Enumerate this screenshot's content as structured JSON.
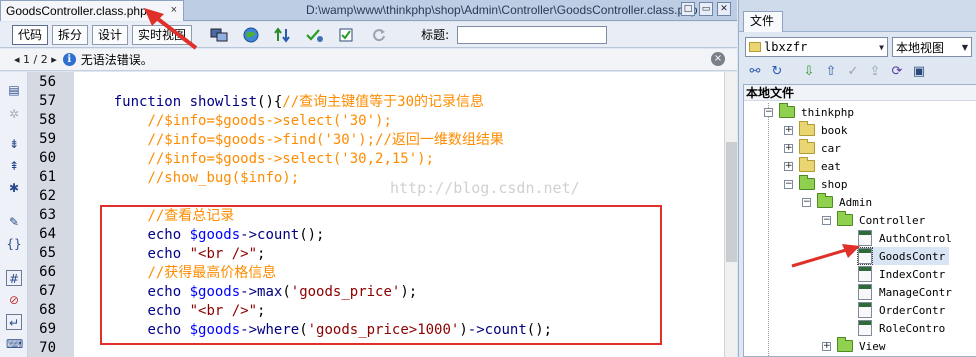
{
  "editor": {
    "tab_title": "GoodsController.class.php",
    "tab_close": "×",
    "file_path": "D:\\wamp\\www\\thinkphp\\shop\\Admin\\Controller\\GoodsController.class.php",
    "window_icons": [
      "□",
      "▭",
      "✕"
    ],
    "toolbar": {
      "buttons": [
        "代码",
        "拆分",
        "设计",
        "实时视图"
      ],
      "active_button": "代码",
      "icons": [
        "multiscreen-icon",
        "globe-icon",
        "transfer-icon",
        "validate-icon",
        "check-icon",
        "refresh-icon"
      ],
      "title_label": "标题:",
      "title_value": ""
    },
    "infobar": {
      "nav": "◂ 1 / 2 ▸",
      "message": "无语法错误。",
      "close": "×"
    },
    "code_lines": [
      {
        "num": "56",
        "text": ""
      },
      {
        "num": "57",
        "text": "function showlist(){//查询主键值等于30的记录信息"
      },
      {
        "num": "58",
        "text": "    //$info=$goods->select('30');"
      },
      {
        "num": "59",
        "text": "    //$info=$goods->find('30');//返回一维数组结果"
      },
      {
        "num": "60",
        "text": "    //$info=$goods->select('30,2,15');"
      },
      {
        "num": "61",
        "text": "    //show_bug($info);"
      },
      {
        "num": "62",
        "text": ""
      },
      {
        "num": "63",
        "text": "    //查看总记录"
      },
      {
        "num": "64",
        "text": "    echo $goods->count();"
      },
      {
        "num": "65",
        "text": "    echo \"<br />\";"
      },
      {
        "num": "66",
        "text": "    //获得最高价格信息"
      },
      {
        "num": "67",
        "text": "    echo $goods->max('goods_price');"
      },
      {
        "num": "68",
        "text": "    echo \"<br />\";"
      },
      {
        "num": "69",
        "text": "    echo $goods->where('goods_price>1000')->count();"
      },
      {
        "num": "70",
        "text": ""
      }
    ],
    "watermark": "http://blog.csdn.net/"
  },
  "files_panel": {
    "tab_title": "文件",
    "site_select": "lbxzfr",
    "view_select": "本地视图",
    "tree_header": "本地文件",
    "tree": [
      {
        "label": "thinkphp",
        "type": "folder",
        "open": true,
        "expander": "−"
      },
      {
        "label": "book",
        "type": "folder",
        "open": false,
        "expander": "+"
      },
      {
        "label": "car",
        "type": "folder",
        "open": false,
        "expander": "+"
      },
      {
        "label": "eat",
        "type": "folder",
        "open": false,
        "expander": "+"
      },
      {
        "label": "shop",
        "type": "folder",
        "open": true,
        "expander": "−"
      },
      {
        "label": "Admin",
        "type": "folder",
        "open": true,
        "expander": "−"
      },
      {
        "label": "Controller",
        "type": "folder",
        "open": true,
        "expander": "−"
      },
      {
        "label": "AuthControl",
        "type": "file"
      },
      {
        "label": "GoodsContr",
        "type": "file",
        "selected": true
      },
      {
        "label": "IndexContr",
        "type": "file"
      },
      {
        "label": "ManageContr",
        "type": "file"
      },
      {
        "label": "OrderContr",
        "type": "file"
      },
      {
        "label": "RoleContro",
        "type": "file"
      },
      {
        "label": "View",
        "type": "folder",
        "open": true,
        "expander": "+"
      }
    ]
  },
  "colors": {
    "keyword": "#00008b",
    "comment": "#ff8c00",
    "variable": "#0000ff",
    "string": "#8b0000",
    "annotation": "#e0302a",
    "gutter": "#d4d9e2"
  }
}
